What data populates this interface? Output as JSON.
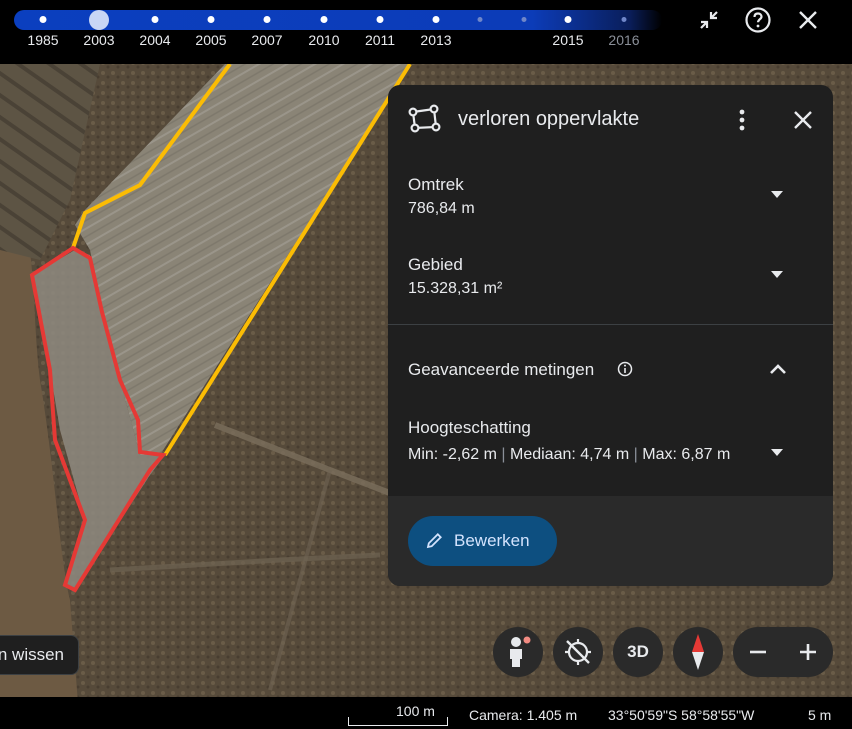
{
  "timeline": {
    "years": [
      {
        "label": "1985",
        "selected": false
      },
      {
        "label": "2003",
        "selected": true
      },
      {
        "label": "2004",
        "selected": false
      },
      {
        "label": "2005",
        "selected": false
      },
      {
        "label": "2007",
        "selected": false
      },
      {
        "label": "2010",
        "selected": false
      },
      {
        "label": "2011",
        "selected": false
      },
      {
        "label": "2013",
        "selected": false
      },
      {
        "label": "2015",
        "selected": false
      },
      {
        "label": "2016",
        "selected": false
      }
    ],
    "icons": [
      "collapse-icon",
      "help-icon",
      "close-icon"
    ]
  },
  "panel": {
    "title": "verloren oppervlakte",
    "perimeter_label": "Omtrek",
    "perimeter_value": "786,84 m",
    "area_label": "Gebied",
    "area_value": "15.328,31 m²",
    "advanced_title": "Geavanceerde metingen",
    "height_label": "Hoogteschatting",
    "height_min": "Min: -2,62 m",
    "height_median": "Mediaan: 4,74 m",
    "height_max": "Max:",
    "height_max_value": "6,87 m",
    "edit_label": "Bewerken"
  },
  "map": {
    "clear_label": "n wissen",
    "controls": [
      "pegman-icon",
      "no-location-icon",
      "3D",
      "compass-icon"
    ],
    "view_mode_label": "3D",
    "polygon_colors": {
      "measurement": "#fbbc04",
      "lost_area": "#e53935"
    }
  },
  "status": {
    "scale": "100 m",
    "camera": "Camera: 1.405 m",
    "coordinates": "33°50'59\"S 58°58'55\"W",
    "elevation": "5 m"
  },
  "colors": {
    "accent": "#0d4f80",
    "panel_bg": "#1f1f1f",
    "timeline": "#0b3fbf"
  }
}
